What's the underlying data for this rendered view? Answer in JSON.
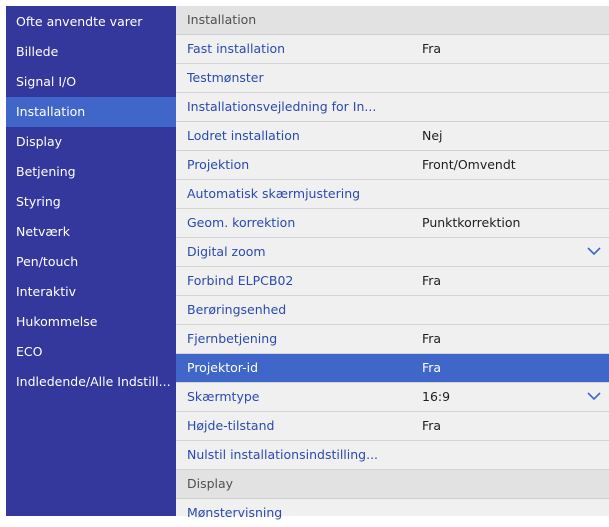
{
  "sidebar": {
    "items": [
      {
        "label": "Ofte anvendte varer"
      },
      {
        "label": "Billede"
      },
      {
        "label": "Signal I/O"
      },
      {
        "label": "Installation"
      },
      {
        "label": "Display"
      },
      {
        "label": "Betjening"
      },
      {
        "label": "Styring"
      },
      {
        "label": "Netværk"
      },
      {
        "label": "Pen/touch"
      },
      {
        "label": "Interaktiv"
      },
      {
        "label": "Hukommelse"
      },
      {
        "label": "ECO"
      },
      {
        "label": "Indledende/Alle Indstill..."
      }
    ],
    "active": "Installation"
  },
  "main": {
    "section_installation": "Installation",
    "rows": [
      {
        "label": "Fast installation",
        "value": "Fra"
      },
      {
        "label": "Testmønster",
        "value": ""
      },
      {
        "label": "Installationsvejledning for In...",
        "value": ""
      },
      {
        "label": "Lodret installation",
        "value": "Nej"
      },
      {
        "label": "Projektion",
        "value": "Front/Omvendt"
      },
      {
        "label": "Automatisk skærmjustering",
        "value": ""
      },
      {
        "label": "Geom. korrektion",
        "value": "Punktkorrektion"
      },
      {
        "label": "Digital zoom",
        "value": "",
        "icon": "chevron-down-icon"
      },
      {
        "label": "Forbind ELPCB02",
        "value": "Fra"
      },
      {
        "label": "Berøringsenhed",
        "value": ""
      },
      {
        "label": "Fjernbetjening",
        "value": "Fra"
      },
      {
        "label": "Projektor-id",
        "value": "Fra",
        "selected": true
      },
      {
        "label": "Skærmtype",
        "value": "16:9",
        "icon": "chevron-down-icon"
      },
      {
        "label": "Højde-tilstand",
        "value": "Fra"
      },
      {
        "label": "Nulstil installationsindstilling...",
        "value": ""
      }
    ],
    "section_display": "Display",
    "display_rows": [
      {
        "label": "Mønstervisning",
        "value": ""
      }
    ]
  },
  "colors": {
    "sidebar_bg": "#34379b",
    "highlight": "#3f66c8",
    "main_bg": "#f0f0f0",
    "link_text": "#2a4ab0"
  }
}
